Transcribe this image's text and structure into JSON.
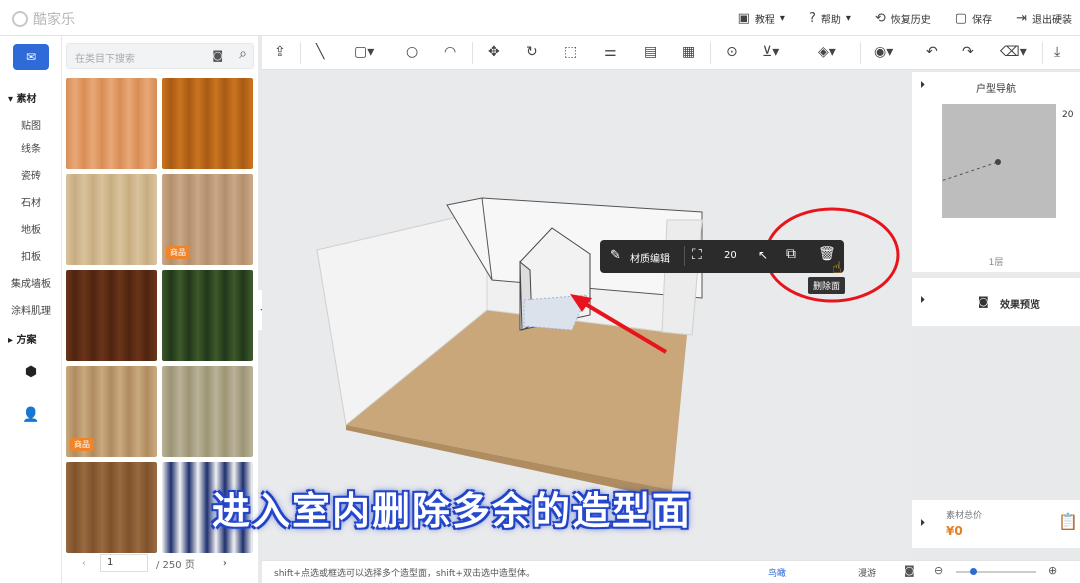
{
  "app": {
    "logo_text": "酷家乐"
  },
  "topmenu": [
    {
      "icon": "tutorial-icon",
      "glyph": "▣",
      "label": "教程",
      "caret": "▾"
    },
    {
      "icon": "help-icon",
      "glyph": "?",
      "label": "帮助",
      "caret": "▾"
    },
    {
      "icon": "history-icon",
      "glyph": "⟲",
      "label": "恢复历史"
    },
    {
      "icon": "save-icon",
      "glyph": "▢",
      "label": "保存"
    },
    {
      "icon": "exit-icon",
      "glyph": "⇥",
      "label": "退出硬装"
    }
  ],
  "leftnav": {
    "section_material": "素材",
    "items": [
      "贴图",
      "线条",
      "瓷砖",
      "石材",
      "地板",
      "扣板",
      "集成墙板",
      "涂料肌理"
    ],
    "section_scheme": "方案",
    "caret_open": "▾",
    "caret_closed": "▸"
  },
  "material_panel": {
    "search_placeholder": "在类目下搜索",
    "badge": "商品",
    "tiles": [
      {
        "colors": [
          "#d98d55",
          "#e8a877"
        ],
        "badge": false
      },
      {
        "colors": [
          "#c9741f",
          "#a95a14"
        ],
        "badge": false
      },
      {
        "colors": [
          "#d9c39d",
          "#c7ad81"
        ],
        "badge": false
      },
      {
        "colors": [
          "#c9a887",
          "#b38f6d"
        ],
        "badge": true
      },
      {
        "colors": [
          "#6a3419",
          "#4e2410"
        ],
        "badge": false
      },
      {
        "colors": [
          "#3d5a2a",
          "#22371a"
        ],
        "badge": false
      },
      {
        "colors": [
          "#c9a97e",
          "#b08b60"
        ],
        "badge": true
      },
      {
        "colors": [
          "#b9b299",
          "#9c9474"
        ],
        "badge": false
      },
      {
        "colors": [
          "#9a6a3f",
          "#7e522c"
        ],
        "badge": false
      },
      {
        "colors": [
          "#f2f2f2",
          "#1e2f6e"
        ],
        "badge": false
      }
    ],
    "pager": {
      "prev": "‹",
      "page": "1",
      "total": "/ 250 页",
      "next": "›"
    }
  },
  "toolbar_icons": [
    "export-icon",
    "line-tool-icon",
    "rectangle-tool-icon",
    "circle-tool-icon",
    "arc-tool-icon",
    "move-icon",
    "rotate-icon",
    "select-face-icon",
    "level-icon",
    "section-icon",
    "material-icon",
    "search-model-icon",
    "align-icon",
    "paint-icon",
    "view-icon",
    "undo-icon",
    "redo-icon",
    "eraser-icon",
    "download-icon"
  ],
  "context_bar": {
    "edit_label": "材质编辑",
    "value": "20",
    "tooltip": "删除面"
  },
  "right_panel": {
    "nav_title": "户型导航",
    "nav_scale": "20",
    "floor_label": "1层",
    "preview_label": "效果预览",
    "cost_label": "素材总价",
    "cost_value": "¥0"
  },
  "status": {
    "hint": "shift+点选或框选可以选择多个造型面，shift+双击选中造型体。",
    "view_birdseye": "鸟瞰",
    "view_walk": "漫游"
  },
  "subtitle": "进入室内删除多余的造型面",
  "colors": {
    "accent": "#2f6bd8",
    "badge": "#f0842b",
    "annotation": "#e8141b"
  }
}
